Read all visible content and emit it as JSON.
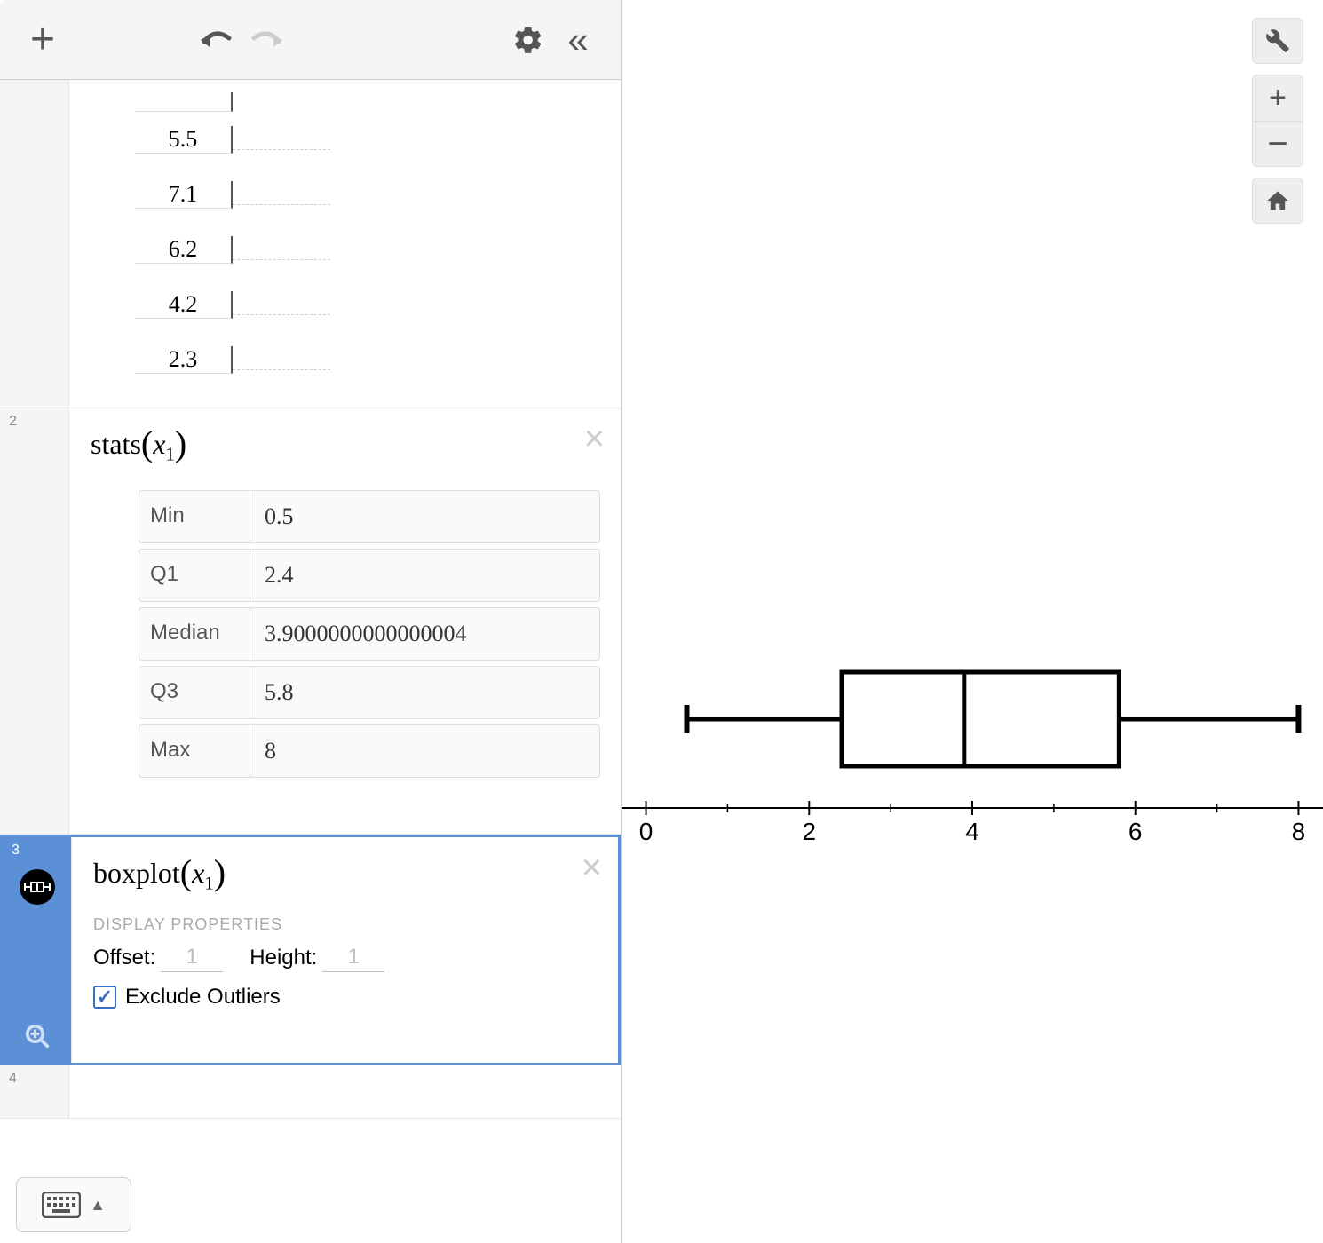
{
  "toolbar": {
    "add": "+",
    "undo": "↶",
    "redo": "↷",
    "settings": "⚙",
    "collapse": "«"
  },
  "data_rows": [
    "5.5",
    "7.1",
    "6.2",
    "4.2",
    "2.3"
  ],
  "stats": {
    "expr": "stats",
    "var": "x",
    "sub": "1",
    "rownum": "2",
    "labels": {
      "min": "Min",
      "q1": "Q1",
      "median": "Median",
      "q3": "Q3",
      "max": "Max"
    },
    "vals": {
      "min": "0.5",
      "q1": "2.4",
      "median": "3.9000000000000004",
      "q3": "5.8",
      "max": "8"
    }
  },
  "boxplot_expr": {
    "rownum": "3",
    "fn": "boxplot",
    "var": "x",
    "sub": "1",
    "disp_title": "DISPLAY PROPERTIES",
    "offset_label": "Offset:",
    "offset_val": "1",
    "height_label": "Height:",
    "height_val": "1",
    "exclude_label": "Exclude Outliers",
    "exclude_checked": true
  },
  "row4": "4",
  "axis_ticks": [
    "0",
    "2",
    "4",
    "6",
    "8"
  ],
  "chart_data": {
    "type": "boxplot",
    "min": 0.5,
    "q1": 2.4,
    "median": 3.9,
    "q3": 5.8,
    "max": 8,
    "x_range": [
      -0.3,
      8.3
    ],
    "ticks": [
      0,
      2,
      4,
      6,
      8
    ]
  }
}
